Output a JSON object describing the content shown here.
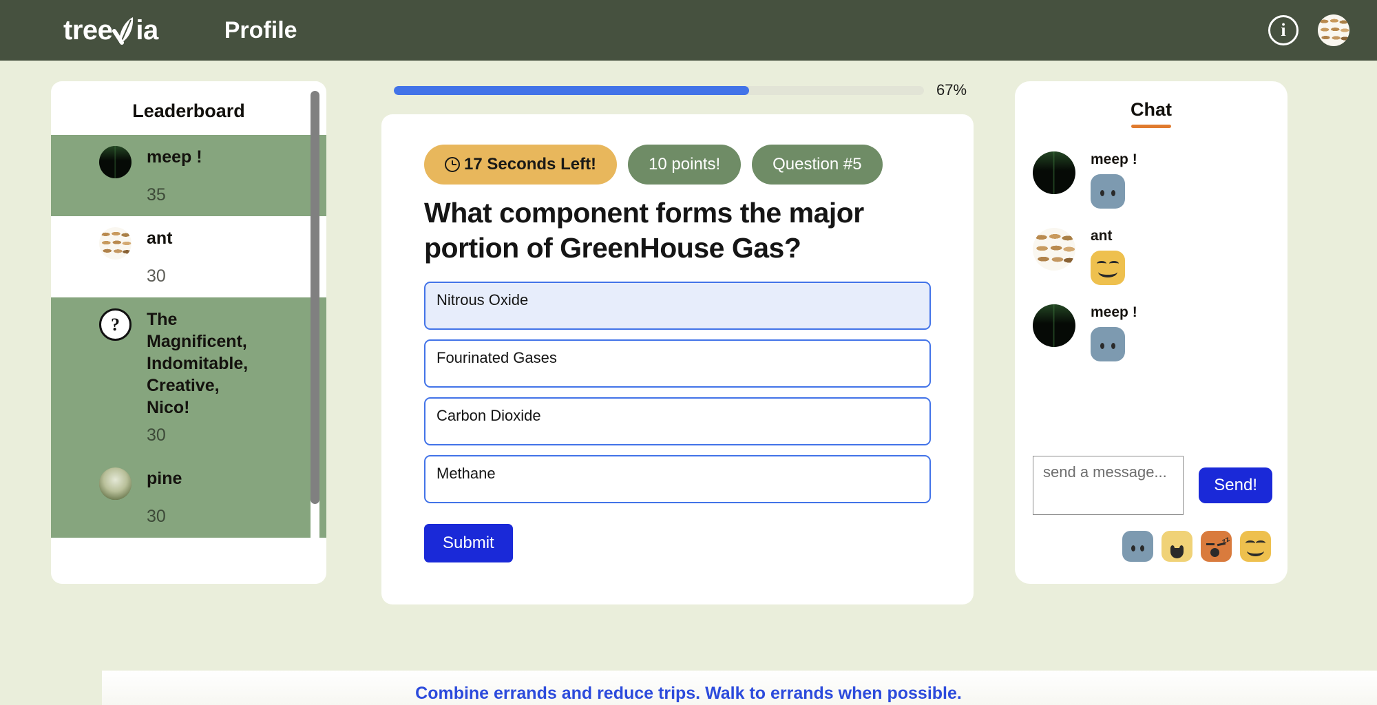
{
  "header": {
    "brand": "treevia",
    "brand_icon": "leaf-icon",
    "nav_link": "Profile",
    "info_icon": "i",
    "info_icon_name": "info-icon",
    "avatar_name": "user-avatar"
  },
  "leaderboard": {
    "title": "Leaderboard",
    "entries": [
      {
        "name": "meep !",
        "score": "35",
        "avatar": "meep-avatar",
        "highlight": true
      },
      {
        "name": "ant",
        "score": "30",
        "avatar": "ant-avatar",
        "highlight": false
      },
      {
        "name": "The Magnificent, Indomitable, Creative, Nico!",
        "score": "30",
        "avatar": "question-avatar",
        "highlight": true
      },
      {
        "name": "pine",
        "score": "30",
        "avatar": "pine-avatar",
        "highlight": true
      }
    ]
  },
  "quiz": {
    "progress_percent": 67,
    "progress_label": "67%",
    "badges": {
      "timer": "17 Seconds Left!",
      "points": "10 points!",
      "question_number": "Question #5"
    },
    "question": "What component forms the major portion of GreenHouse Gas?",
    "options": [
      {
        "label": "Nitrous Oxide",
        "selected": true
      },
      {
        "label": "Fourinated Gases",
        "selected": false
      },
      {
        "label": "Carbon Dioxide",
        "selected": false
      },
      {
        "label": "Methane",
        "selected": false
      }
    ],
    "submit_label": "Submit"
  },
  "chat": {
    "title": "Chat",
    "messages": [
      {
        "user": "meep !",
        "avatar": "meep-avatar",
        "emoji": "neutral-blue-face",
        "emoji_color": "#7d9ab0"
      },
      {
        "user": "ant",
        "avatar": "ant-avatar",
        "emoji": "smiling-face",
        "emoji_color": "#eec04e"
      },
      {
        "user": "meep !",
        "avatar": "meep-avatar",
        "emoji": "neutral-blue-face",
        "emoji_color": "#7d9ab0"
      }
    ],
    "input_placeholder": "send a message...",
    "input_value": "",
    "send_label": "Send!",
    "emoji_options": [
      {
        "name": "neutral-blue-face",
        "color": "#7d9ab0"
      },
      {
        "name": "grin-face",
        "color": "#f0d277"
      },
      {
        "name": "sleeping-face",
        "color": "#d97b3d"
      },
      {
        "name": "content-face",
        "color": "#eec04e"
      }
    ]
  },
  "footer": {
    "tip": "Combine errands and reduce trips. Walk to errands when possible."
  },
  "colors": {
    "page_background": "#eaeedb",
    "header": "#46513f",
    "accent_green": "#86a57e",
    "accent_blue": "#1a29d8",
    "progress_blue": "#4273e8",
    "badge_gold": "#e8b75c",
    "chat_underline": "#e07b2f"
  }
}
